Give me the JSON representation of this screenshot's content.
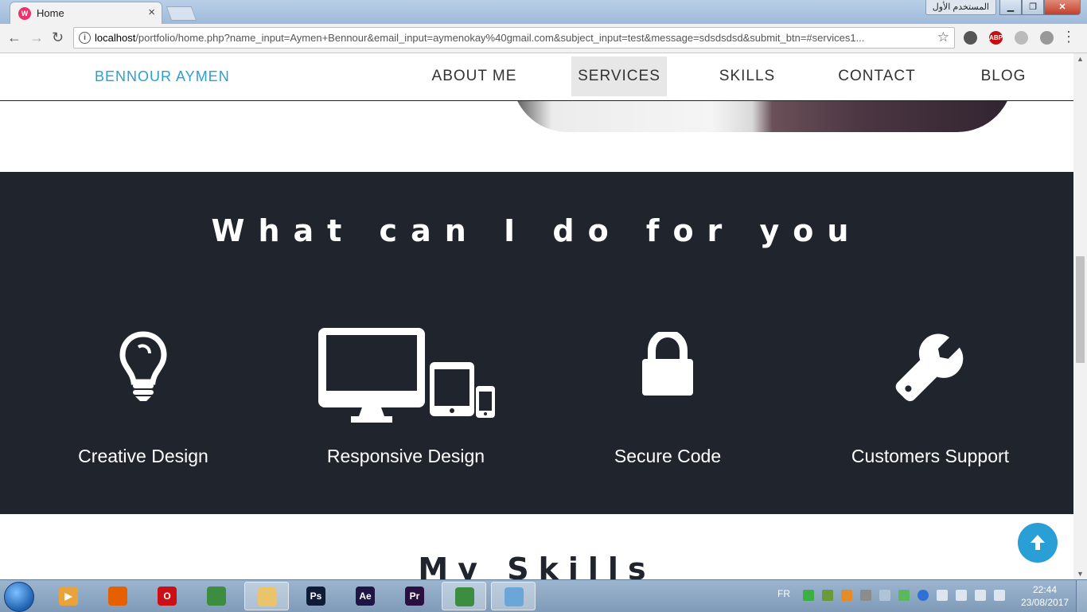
{
  "browser": {
    "tab_title": "Home",
    "tab_favicon": "W",
    "tab_close": "×",
    "user_badge": "المستخدم الأول",
    "url_host": "localhost",
    "url_path": "/portfolio/home.php?name_input=Aymen+Bennour&email_input=aymenokay%40gmail.com&subject_input=test&message=sdsdsdsd&submit_btn=#services1...",
    "info_glyph": "i",
    "back_glyph": "←",
    "forward_glyph": "→",
    "reload_glyph": "↻",
    "star_glyph": "☆",
    "menu_glyph": "⋮",
    "minimize_glyph": "▁",
    "maximize_glyph": "❐",
    "close_glyph": "✕",
    "abp_label": "ABP",
    "extensions": [
      "compass-icon",
      "adblock-plus-icon",
      "puzzle-icon",
      "cloud-icon"
    ]
  },
  "site": {
    "brand": "BENNOUR AYMEN",
    "nav": [
      "ABOUT ME",
      "SERVICES",
      "SKILLS",
      "CONTACT",
      "BLOG"
    ],
    "active_nav": "SERVICES",
    "brand_color": "#2a9fd6"
  },
  "services": {
    "title": "What can I do for you",
    "background": "#20252d",
    "items": [
      {
        "label": "Creative Design",
        "icon": "lightbulb-icon"
      },
      {
        "label": "Responsive Design",
        "icon": "devices-icon"
      },
      {
        "label": "Secure Code",
        "icon": "lock-icon"
      },
      {
        "label": "Customers Support",
        "icon": "wrench-icon"
      }
    ]
  },
  "skills": {
    "title": "My Skills"
  },
  "taskbar": {
    "apps": [
      {
        "name": "media-center",
        "label": "▶",
        "color": "#e8a33b",
        "active": false
      },
      {
        "name": "firefox",
        "label": "",
        "color": "#e66000",
        "active": false
      },
      {
        "name": "opera",
        "label": "O",
        "color": "#cc0f16",
        "active": false
      },
      {
        "name": "chrome",
        "label": "",
        "color": "#3c8d3f",
        "active": false
      },
      {
        "name": "explorer",
        "label": "",
        "color": "#e9c46a",
        "active": true
      },
      {
        "name": "photoshop",
        "label": "Ps",
        "color": "#0e1c3a",
        "active": false
      },
      {
        "name": "after-effects",
        "label": "Ae",
        "color": "#1e1545",
        "active": false
      },
      {
        "name": "premiere",
        "label": "Pr",
        "color": "#2a1040",
        "active": false
      },
      {
        "name": "chrome-active",
        "label": "",
        "color": "#3c8d3f",
        "active": true
      },
      {
        "name": "paint",
        "label": "",
        "color": "#6aa7d8",
        "active": true
      }
    ],
    "language": "FR",
    "time": "22:44",
    "date": "23/08/2017"
  }
}
